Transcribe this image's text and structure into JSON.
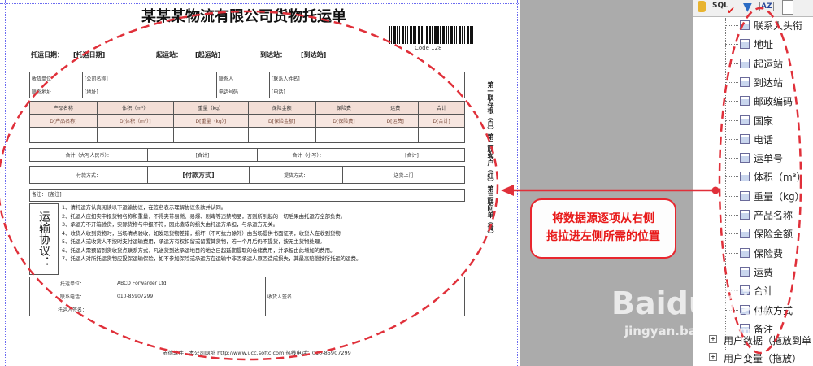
{
  "document": {
    "title": "某某某物流有限公司货物托运单",
    "ship_date_label": "托运日期：",
    "ship_date_value": "[托运日期]",
    "origin_label": "起运站：",
    "origin_value": "[起运站]",
    "dest_label": "到达站：",
    "dest_value": "[到达站]",
    "barcode_caption": "Code 128",
    "row1": [
      "收货单位",
      "[公司名称]",
      "联系人",
      "[联系人姓名]"
    ],
    "row2": [
      "联系地址",
      "[地址]",
      "电话号码",
      "[电话]"
    ],
    "columns": [
      "产品名称",
      "体积（m³）",
      "重量（kg）",
      "保险金额",
      "保险费",
      "运费",
      "合计"
    ],
    "columns_bound": [
      "D[产品名称]",
      "D[体积（m³）]",
      "D[重量（kg）]",
      "D[保险金额]",
      "D[保险费]",
      "D[运费]",
      "D[合计]"
    ],
    "total_upper_label": "合计（大写人民币）：",
    "total_upper_value": "[合计]",
    "total_lower_label": "合计（小写）：",
    "total_lower_value": "[合计]",
    "pay_label": "付款方式：",
    "pay_value": "[付款方式]",
    "pickup_label": "提货方式：",
    "pickup_value": "送货上门",
    "remark_label": "备注：",
    "remark_value": "[备注]",
    "agreement_label": "运输协议：",
    "terms": [
      "1、请托运方认真阅读以下运输协议，在签名表示理解协议条款并认同。",
      "2、托运人应如实申报货物名称和重量，不得夹带易燃、易爆、剧毒等违禁物品，否则所引起的一切后果由托运方全部负责。",
      "3、承运方不开箱验货，实际货物与申报不符，因此造成的损失由托运方承担，与承运方无关。",
      "4、收货人收到货物时，当场清点验收，如发现货物差错，损坏（不可抗力除外）由当场提供书面证明，收货人在收到货物",
      "5、托运人或收货人不按时支付运输费用，承运方有权扣留或留置其货物，若一个月后仍不提货，按无主货物处理。",
      "6、托运人需预留到货收货点联系方式，凡送货到达承运地目的地之日起延期提取的仓储费用，并承担由此增加的费用。",
      "7、托运人对所托运货物应投保运输保险，如不参加保险或承运方在运输中非因承运人原因造成损失，其最高赔偿按所托运的运费。"
    ],
    "sign": {
      "shipper_unit_label": "托运单位：",
      "shipper_unit_value": "ABCD Forwarder Ltd.",
      "contact_phone_label": "联系电话：",
      "contact_phone_value": "010-85907299",
      "shipper_sign_label": "托运人签名：",
      "receiver_sign_label": "收货人签名："
    },
    "footer": "赤德软件：本公司网址 http://www.ucc.softc.com    热线电话：010-85907299",
    "side_text": "第一联存根（白）第二联客户（红）第三联回单（黄）"
  },
  "callout": {
    "line1": "将数据源逐项从右侧",
    "line2": "拖拉进左侧所需的位置"
  },
  "toolbar": {
    "sql": "SQL",
    "sort": "AZ"
  },
  "fields": [
    "联系人头衔",
    "地址",
    "起运站",
    "到达站",
    "邮政编码",
    "国家",
    "电话",
    "运单号",
    "体积（m³）",
    "重量（kg）",
    "产品名称",
    "保险金额",
    "保险费",
    "运费",
    "合计",
    "付款方式",
    "备注"
  ],
  "bottom_nodes": [
    "用户数据（拖放到单",
    "用户变量（拖放）"
  ],
  "watermark": {
    "brand": "Baidu经验",
    "url": "jingyan.baidu.com"
  }
}
